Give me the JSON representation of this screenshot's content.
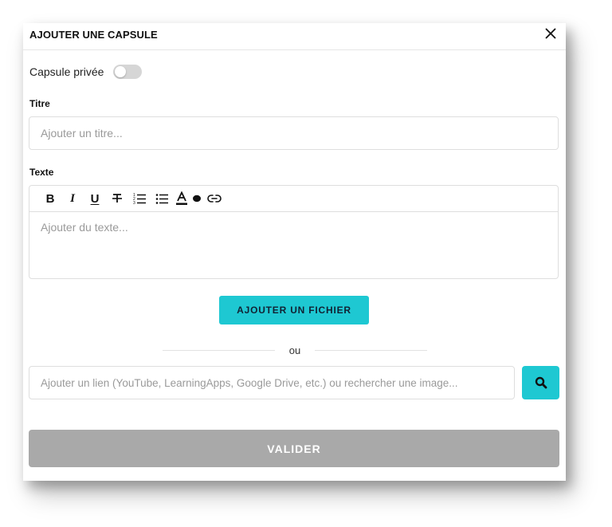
{
  "modal": {
    "title": "AJOUTER UNE CAPSULE",
    "close_icon": "close-icon"
  },
  "privacy": {
    "label": "Capsule privée",
    "toggle_on": false
  },
  "title_field": {
    "label": "Titre",
    "placeholder": "Ajouter un titre...",
    "value": ""
  },
  "text_field": {
    "label": "Texte",
    "placeholder": "Ajouter du texte...",
    "toolbar": {
      "bold": "B",
      "italic": "I",
      "underline": "U",
      "strike": "S",
      "icons": [
        "bold-icon",
        "italic-icon",
        "underline-icon",
        "strikethrough-icon",
        "ordered-list-icon",
        "bullet-list-icon",
        "text-color-icon",
        "highlight-dot-icon",
        "link-icon"
      ]
    }
  },
  "file_button": {
    "label": "AJOUTER UN FICHIER"
  },
  "separator": {
    "text": "ou"
  },
  "link_field": {
    "placeholder": "Ajouter un lien (YouTube, LearningApps, Google Drive, etc.) ou rechercher une image...",
    "value": "",
    "search_icon": "search-icon"
  },
  "submit": {
    "label": "VALIDER"
  },
  "colors": {
    "accent": "#1ec8d2",
    "disabled_button": "#a9a9a9",
    "toggle_off": "#d6d6d6",
    "border": "#dedede"
  }
}
